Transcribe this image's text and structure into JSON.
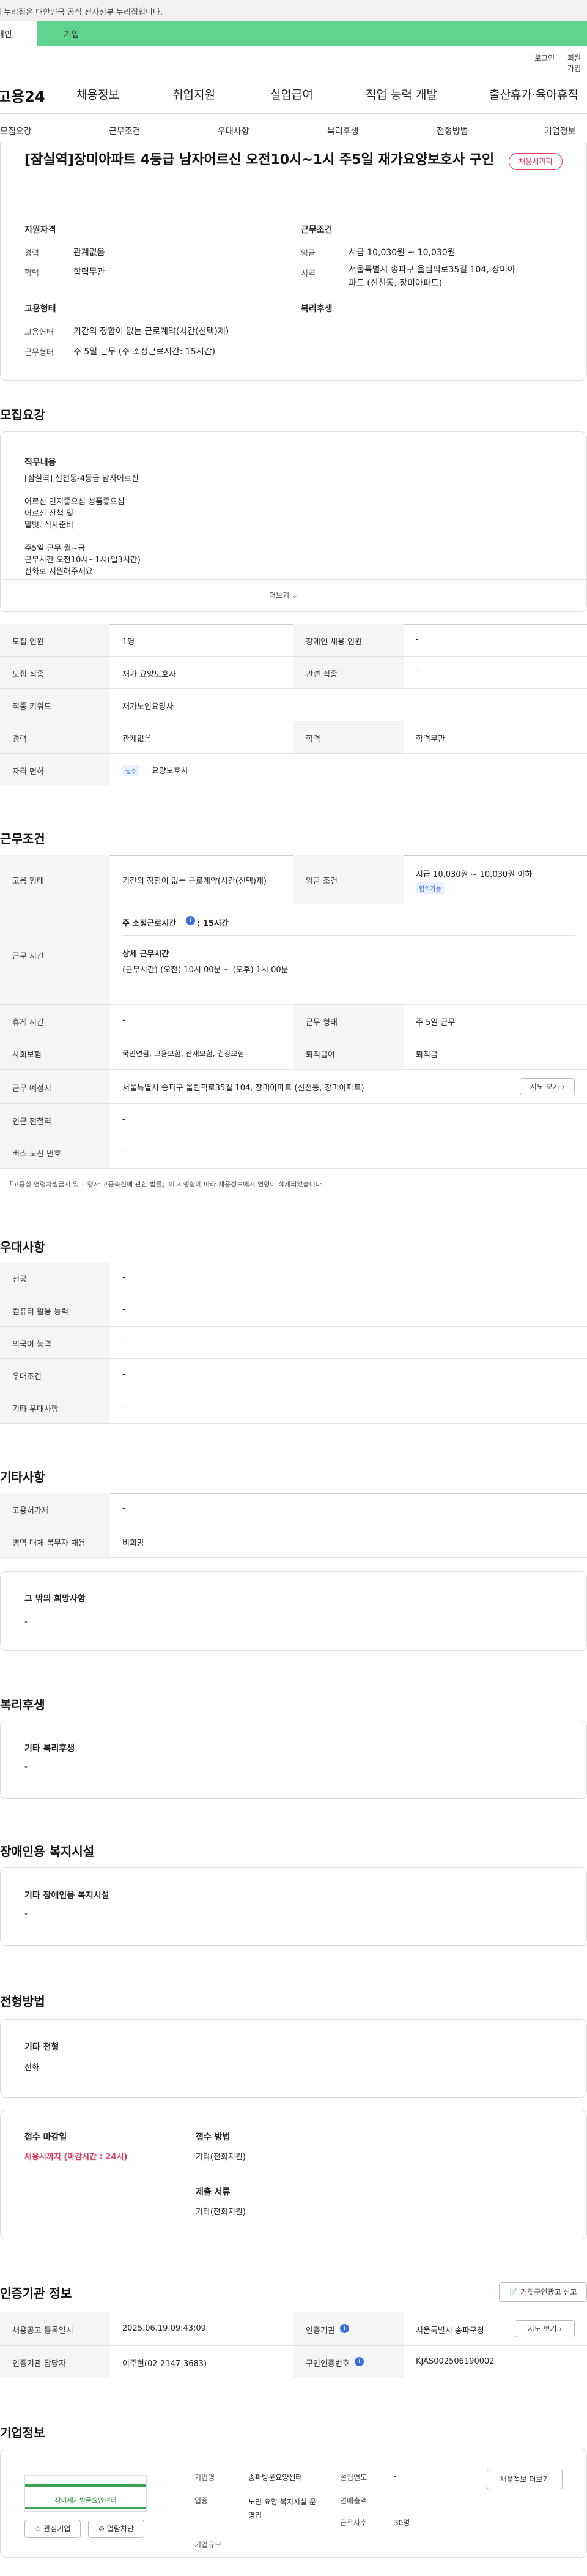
{
  "gov_notice": "이 누리집은 대한민국 공식 전자정부 누리집입니다.",
  "user_tabs": {
    "individual": "개인",
    "company": "기업"
  },
  "util": {
    "login": "로그인",
    "signup": "회원가입"
  },
  "logo_text": "고용24",
  "gnb": [
    "채용정보",
    "취업지원",
    "실업급여",
    "직업 능력 개발",
    "출산휴가·육아휴직"
  ],
  "subnav": [
    "모집요강",
    "근무조건",
    "우대사항",
    "복리후생",
    "전형방법",
    "기업정보"
  ],
  "header": {
    "title": "[잠실역]장미아파트 4등급 남자어르신 오전10시~1시 주5일 재가요양보호사 구인",
    "badge": "채용시까지",
    "qualification": {
      "heading": "지원자격",
      "rows": [
        {
          "label": "경력",
          "value": "관계없음"
        },
        {
          "label": "학력",
          "value": "학력무관"
        }
      ]
    },
    "conditions": {
      "heading": "근무조건",
      "rows": [
        {
          "label": "임금",
          "value": "시급 10,030원 ~ 10,030원"
        },
        {
          "label": "지역",
          "value": "서울특별시 송파구 올림픽로35길 104, 장미아파트 (신천동, 장미아파트)"
        }
      ]
    },
    "employment": {
      "heading": "고용형태",
      "rows": [
        {
          "label": "고용형태",
          "value": "기간의 정함이 없는 근로계약(시간(선택)제)"
        },
        {
          "label": "근무형태",
          "value": "주 5일 근무 (주 소정근로시간: 15시간)"
        }
      ]
    },
    "benefits_heading": "복리후생"
  },
  "recruit": {
    "heading": "모집요강",
    "job_title": "직무내용",
    "job_lines": [
      "[잠실역] 신천동-4등급 남자어르신",
      "",
      "어르신 인지좋으심 성품좋으심",
      "어르신 산책 및",
      "말벗, 식사준비",
      "",
      "주5일 근무 월~금",
      "근무시간 오전10시~1시(일3시간)",
      "전화로 지원해주세요"
    ],
    "more": "더보기",
    "table": [
      {
        "l1": "모집 인원",
        "v1": "1명",
        "l2": "장애인 채용 인원",
        "v2": "-"
      },
      {
        "l1": "모집 직종",
        "v1": "재가 요양보호사",
        "l2": "관련 직종",
        "v2": "-"
      },
      {
        "l1": "직종 키워드",
        "v1": "재가노인요양사"
      },
      {
        "l1": "경력",
        "v1": "관계없음",
        "l2": "학력",
        "v2": "학력무관"
      },
      {
        "l1": "자격 면허",
        "chip": "필수",
        "v1": "요양보호사"
      }
    ]
  },
  "work": {
    "heading": "근무조건",
    "employ_label": "고용 형태",
    "employ_value": "기간의 정함이 없는 근로계약(시간(선택)제)",
    "wage_label": "임금 조건",
    "wage_value": "시급 10,030원 ~ 10,030원 이하",
    "wage_chip": "협의가능",
    "time_label": "근무 시간",
    "weekly_hours": "주 소정근로시간",
    "weekly_hours_value": ": 15시간",
    "detail_title": "상세 근무시간",
    "detail_value": "(근무시간) (오전) 10시 00분 ~ (오후) 1시 00분",
    "rows": [
      {
        "l1": "휴게 시간",
        "v1": "-",
        "l2": "근무 형태",
        "v2": "주 5일 근무"
      },
      {
        "l1": "사회보험",
        "v1": "국민연금, 고용보험, 산재보험, 건강보험",
        "l2": "퇴직급여",
        "v2": "퇴직금"
      }
    ],
    "location_label": "근무 예정지",
    "location_value": "서울특별시 송파구 올림픽로35길 104, 장미아파트 (신천동, 장미아파트)",
    "map_btn": "지도 보기",
    "station_label": "인근 전철역",
    "station_value": "-",
    "bus_label": "버스 노선 번호",
    "bus_value": "-",
    "note": "「고용상 연령차별금지 및 고령자 고용촉진에 관한 법률」이 시행함에 따라 채용정보에서 연령이 삭제되었습니다."
  },
  "preference": {
    "heading": "우대사항",
    "rows": [
      {
        "label": "전공",
        "value": "-"
      },
      {
        "label": "컴퓨터 활용 능력",
        "value": "-"
      },
      {
        "label": "외국어 능력",
        "value": "-"
      },
      {
        "label": "우대조건",
        "value": "-"
      },
      {
        "label": "기타 우대사항",
        "value": "-"
      }
    ]
  },
  "etc": {
    "heading": "기타사항",
    "rows": [
      {
        "label": "고용허가제",
        "value": "-"
      },
      {
        "label": "병역 대체 복무자 채용",
        "value": "비희망"
      }
    ],
    "other_title": "그 밖의 희망사항",
    "other_value": "-"
  },
  "welfare": {
    "heading": "복리후생",
    "title": "기타 복리후생",
    "value": "-"
  },
  "disabled": {
    "heading": "장애인용 복지시설",
    "title": "기타 장애인용 복지시설",
    "value": "-"
  },
  "selection": {
    "heading": "전형방법",
    "other_title": "기타 전형",
    "other_value": "전화",
    "deadline_title": "접수 마감일",
    "deadline_value": "채용시까지 (마감시간 : 24시)",
    "method_title": "접수 방법",
    "method_value": "기타(전화지원)",
    "docs_title": "제출 서류",
    "docs_value": "기타(전화지원)"
  },
  "agency": {
    "heading": "인증기관 정보",
    "report_btn": "거짓구인광고 신고",
    "rows": [
      {
        "l1": "채용공고 등록일시",
        "v1": "2025.06.19 09:43:09",
        "l2": "인증기관",
        "v2": "서울특별시 송파구청"
      },
      {
        "l1": "인증기관 담당자",
        "v1": "이주현(02-2147-3683)",
        "l2": "구인인증번호",
        "v2": "KJAS002506190002"
      }
    ],
    "map_btn": "지도 보기"
  },
  "company": {
    "heading": "기업정보",
    "logo_text": "장미재가방문요양센터",
    "interest_btn": "관심기업",
    "block_btn": "열람차단",
    "detail_btn": "채용정보 더보기",
    "fields": [
      {
        "label": "기업명",
        "value": "송파방문요양센터"
      },
      {
        "label": "업종",
        "value": "노인 요양 복지시설 운영업"
      },
      {
        "label": "기업규모",
        "value": "-"
      }
    ],
    "fields2": [
      {
        "label": "설립연도",
        "value": "-"
      },
      {
        "label": "연매출액",
        "value": "-"
      },
      {
        "label": "근로자수",
        "value": "30명"
      }
    ]
  }
}
